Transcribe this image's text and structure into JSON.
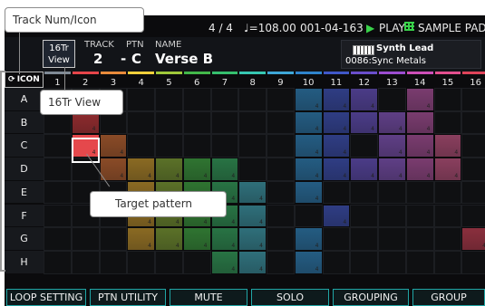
{
  "status_bar": {
    "beat": "4 / 4",
    "tempo": "♩=108.00",
    "position": "001-04-163",
    "play_icon": "play-icon",
    "play_state": "PLAY",
    "pad_icon": "pad-grid-icon",
    "pad_label": "SAMPLE PAD"
  },
  "header": {
    "view_button": [
      "16Tr",
      "View"
    ],
    "track_label": "TRACK",
    "track_value": "2",
    "dash": "-",
    "ptn_label": "PTN",
    "ptn_value": "C",
    "name_label": "NAME",
    "name_value": "Verse B",
    "tone": {
      "icon": "keyboard-icon",
      "name": "Synth Lead",
      "number": "0086:Sync Metals"
    }
  },
  "grid": {
    "icon_button": "ICON",
    "icon_symbol": "cycle-arrow-icon",
    "columns": [
      {
        "label": "1",
        "color": "#7f8a95"
      },
      {
        "label": "2",
        "color": "#e6454a"
      },
      {
        "label": "3",
        "color": "#e98b3b"
      },
      {
        "label": "4",
        "color": "#f2d03b"
      },
      {
        "label": "5",
        "color": "#a0c83a"
      },
      {
        "label": "6",
        "color": "#43b84a"
      },
      {
        "label": "7",
        "color": "#36bf6e"
      },
      {
        "label": "8",
        "color": "#37c7b2"
      },
      {
        "label": "9",
        "color": "#3ea7d8"
      },
      {
        "label": "10",
        "color": "#2f84cc"
      },
      {
        "label": "11",
        "color": "#4058c8"
      },
      {
        "label": "12",
        "color": "#6a4ecb"
      },
      {
        "label": "13",
        "color": "#9c4dd1"
      },
      {
        "label": "14",
        "color": "#cd4fb8"
      },
      {
        "label": "15",
        "color": "#e34f8f"
      },
      {
        "label": "16",
        "color": "#e0445a"
      }
    ],
    "rows": [
      "A",
      "B",
      "C",
      "D",
      "E",
      "F",
      "G",
      "H"
    ],
    "fill_colors": [
      "#3a4047",
      "#8e2b2e",
      "#8a4b27",
      "#8a6a23",
      "#5b7128",
      "#2f7431",
      "#287344",
      "#2f6f7a",
      "#486f87",
      "#245c82",
      "#2f3d84",
      "#4b3c88",
      "#5f3f86",
      "#7a3c6f",
      "#8a3f5e",
      "#8a2f3d"
    ],
    "filled": [
      [],
      [
        1,
        2
      ],
      [
        2,
        3
      ],
      [
        3,
        4,
        5,
        6
      ],
      [
        3,
        4,
        5,
        6
      ],
      [
        3,
        4,
        5,
        6
      ],
      [
        3,
        4,
        5,
        6,
        7
      ],
      [
        4,
        5,
        6,
        7
      ],
      [],
      [
        0,
        1,
        2,
        3,
        4,
        6,
        7
      ],
      [
        0,
        1,
        2,
        3,
        5
      ],
      [
        0,
        1,
        3
      ],
      [
        1,
        2,
        3
      ],
      [
        0,
        1,
        2,
        3
      ],
      [
        2,
        3
      ],
      [
        6
      ]
    ],
    "target_cell": {
      "col": 1,
      "row": 2
    }
  },
  "bottom_buttons": [
    "LOOP SETTING",
    "PTN UTILITY",
    "MUTE",
    "SOLO",
    "GROUPING",
    "GROUP"
  ],
  "callouts": {
    "track_num_icon": "Track Num/Icon",
    "view_16tr": "16Tr View",
    "target_pattern": "Target pattern"
  }
}
